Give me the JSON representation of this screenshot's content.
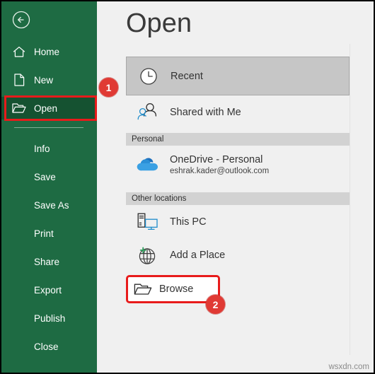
{
  "window": {
    "title": "Open",
    "watermark": "wsxdn.com"
  },
  "sidebar": {
    "back_button": {
      "icon": "back-arrow-icon",
      "label": "Back"
    },
    "items": [
      {
        "label": "Home",
        "icon": "home-icon",
        "selected": false,
        "indented": false
      },
      {
        "label": "New",
        "icon": "new-file-icon",
        "selected": false,
        "indented": false
      },
      {
        "label": "Open",
        "icon": "folder-open-icon",
        "selected": true,
        "indented": false
      },
      {
        "label": "Info",
        "icon": "",
        "selected": false,
        "indented": true
      },
      {
        "label": "Save",
        "icon": "",
        "selected": false,
        "indented": true
      },
      {
        "label": "Save As",
        "icon": "",
        "selected": false,
        "indented": true
      },
      {
        "label": "Print",
        "icon": "",
        "selected": false,
        "indented": true
      },
      {
        "label": "Share",
        "icon": "",
        "selected": false,
        "indented": true
      },
      {
        "label": "Export",
        "icon": "",
        "selected": false,
        "indented": true
      },
      {
        "label": "Publish",
        "icon": "",
        "selected": false,
        "indented": true
      },
      {
        "label": "Close",
        "icon": "",
        "selected": false,
        "indented": true
      }
    ],
    "background_color": "#1e6b43",
    "selected_background_color": "#155231"
  },
  "main": {
    "heading": "Open",
    "places": {
      "recent": {
        "label": "Recent",
        "icon": "clock-icon",
        "selected": true
      },
      "shared_with_me": {
        "label": "Shared with Me",
        "icon": "people-icon",
        "selected": false
      }
    },
    "sections": [
      {
        "header": "Personal",
        "items": [
          {
            "label": "OneDrive - Personal",
            "sublabel": "eshrak.kader@outlook.com",
            "icon": "onedrive-cloud-icon"
          }
        ]
      },
      {
        "header": "Other locations",
        "items": [
          {
            "label": "This PC",
            "sublabel": "",
            "icon": "this-pc-icon"
          },
          {
            "label": "Add a Place",
            "sublabel": "",
            "icon": "globe-plus-icon"
          },
          {
            "label": "Browse",
            "sublabel": "",
            "icon": "folder-icon",
            "highlighted": true
          }
        ]
      }
    ]
  },
  "annotations": {
    "highlight_color": "#e81b1b",
    "badge_color": "#e03a34",
    "badges": [
      {
        "number": "1",
        "target": "sidebar-item-open"
      },
      {
        "number": "2",
        "target": "place-browse"
      }
    ]
  }
}
